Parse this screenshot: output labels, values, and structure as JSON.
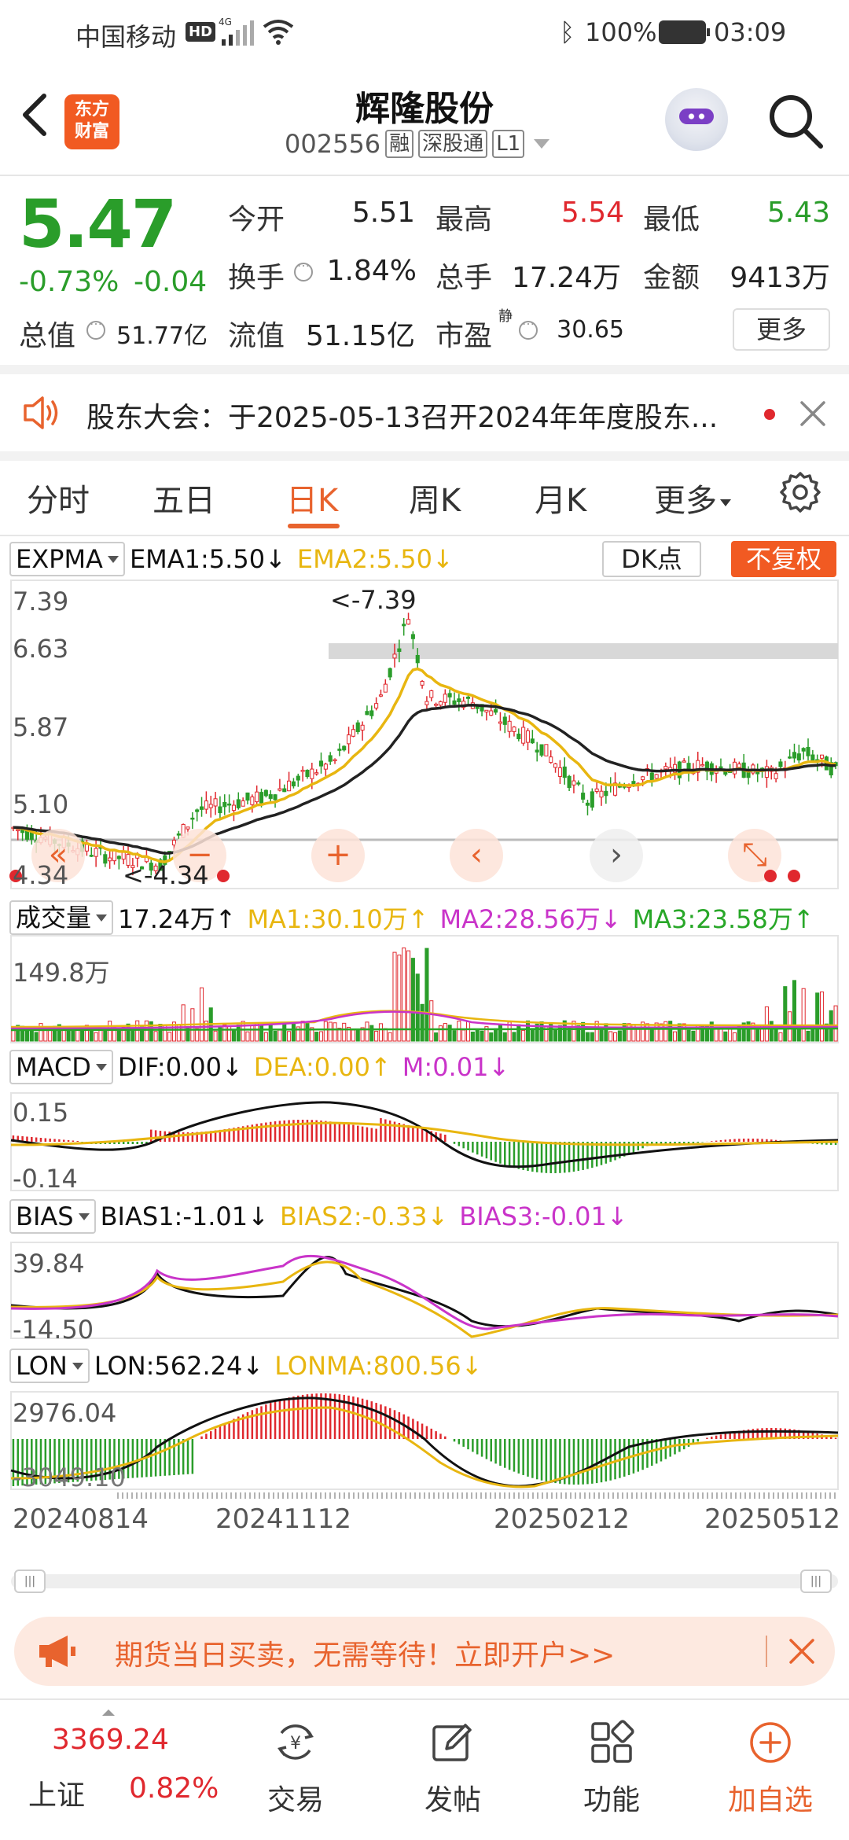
{
  "status_bar": {
    "carrier": "中国移动",
    "hd": "HD",
    "network": "4G",
    "battery": "100%",
    "time": "03:09"
  },
  "header": {
    "logo_text_1": "东方",
    "logo_text_2": "财富",
    "stock_name": "辉隆股份",
    "stock_code": "002556",
    "tags": [
      "融",
      "深股通",
      "L1"
    ]
  },
  "quote": {
    "price": "5.47",
    "change_pct": "-0.73%",
    "change": "-0.04",
    "labels": {
      "open": "今开",
      "high": "最高",
      "low": "最低",
      "turnover": "换手",
      "volume": "总手",
      "amount": "金额",
      "mcap": "总值",
      "float_cap": "流值",
      "pe": "市盈",
      "pe_sup": "静"
    },
    "values": {
      "open": "5.51",
      "high": "5.54",
      "low": "5.43",
      "turnover": "1.84%",
      "volume": "17.24万",
      "amount": "9413万",
      "mcap": "51.77亿",
      "float_cap": "51.15亿",
      "pe": "30.65"
    },
    "more_label": "更多"
  },
  "notice": {
    "text": "股东大会：于2025-05-13召开2024年年度股东..."
  },
  "tabs": {
    "items": [
      "分时",
      "五日",
      "日K",
      "周K",
      "月K",
      "更多"
    ],
    "active": "日K"
  },
  "kline": {
    "indicator": "EXPMA",
    "ema1": "EMA1:5.50↓",
    "ema2": "EMA2:5.50↓",
    "dk_label": "DK点",
    "adjust_label": "不复权",
    "axis": [
      "7.39",
      "6.63",
      "5.87",
      "5.10",
      "4.34"
    ],
    "high_mark": "<-7.39",
    "low_mark": "<-4.34"
  },
  "volume": {
    "indicator": "成交量",
    "value": "17.24万↑",
    "ma1": "MA1:30.10万↑",
    "ma2": "MA2:28.56万↓",
    "ma3": "MA3:23.58万↑",
    "axis_max": "149.8万"
  },
  "macd": {
    "indicator": "MACD",
    "dif": "DIF:0.00↓",
    "dea": "DEA:0.00↑",
    "m": "M:0.01↓",
    "axis_max": "0.15",
    "axis_min": "-0.14"
  },
  "bias": {
    "indicator": "BIAS",
    "bias1": "BIAS1:-1.01↓",
    "bias2": "BIAS2:-0.33↓",
    "bias3": "BIAS3:-0.01↓",
    "axis_max": "39.84",
    "axis_min": "-14.50"
  },
  "lon": {
    "indicator": "LON",
    "lon": "LON:562.24↓",
    "lonma": "LONMA:800.56↓",
    "axis_max": "2976.04",
    "axis_min": "-3049.10"
  },
  "dates": [
    "20240814",
    "20241112",
    "20250212",
    "20250512"
  ],
  "promo": {
    "text": "期货当日买卖，无需等待！立即开户>>"
  },
  "bottom_nav": {
    "index_value": "3369.24",
    "index_name": "上证",
    "index_pct": "0.82%",
    "items": [
      "交易",
      "发帖",
      "功能",
      "加自选"
    ]
  },
  "colors": {
    "accent": "#e8632e",
    "up": "#e0282e",
    "down": "#2a9d2a",
    "ema1": "#222222",
    "ema2": "#e8b610"
  }
}
